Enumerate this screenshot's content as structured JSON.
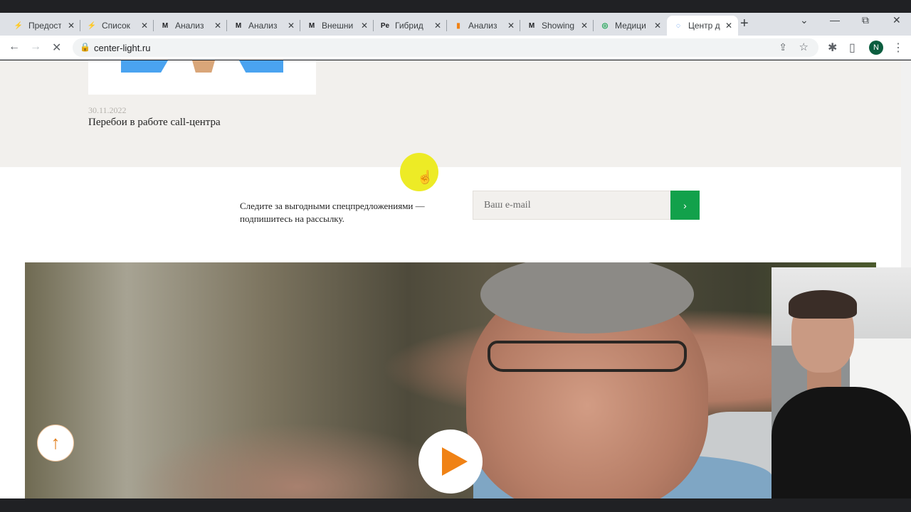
{
  "browser": {
    "tabs": [
      {
        "title": "Предост",
        "icon": "red-logo-icon",
        "color": "#d93025",
        "glyph": "⚡"
      },
      {
        "title": "Список",
        "icon": "red-logo-icon",
        "color": "#d93025",
        "glyph": "⚡"
      },
      {
        "title": "Анализ",
        "icon": "m-logo-icon",
        "color": "#202124",
        "glyph": "M"
      },
      {
        "title": "Анализ",
        "icon": "m-logo-icon",
        "color": "#202124",
        "glyph": "M"
      },
      {
        "title": "Внешни",
        "icon": "m-logo-icon",
        "color": "#202124",
        "glyph": "M"
      },
      {
        "title": "Гибрид",
        "icon": "pe-logo-icon",
        "color": "#202124",
        "glyph": "Pe"
      },
      {
        "title": "Анализ",
        "icon": "orange-logo-icon",
        "color": "#f08215",
        "glyph": "▮"
      },
      {
        "title": "Showing",
        "icon": "m-bird-logo-icon",
        "color": "#202124",
        "glyph": "M"
      },
      {
        "title": "Медици",
        "icon": "green-logo-icon",
        "color": "#12a14b",
        "glyph": "◎"
      },
      {
        "title": "Центр д",
        "icon": "loading-icon",
        "color": "#1a73e8",
        "glyph": "◌"
      }
    ],
    "active_tab_index": 9,
    "new_tab_symbol": "+",
    "url": "center-light.ru",
    "profile_initial": "N"
  },
  "page": {
    "news_date": "30.11.2022",
    "news_title": "Перебои в работе call-центра",
    "subscribe_text": "Следите за выгодными спецпредложениями — подпишитесь на рассылку.",
    "email_placeholder": "Ваш e-mail",
    "submit_symbol": "›",
    "scroll_up_symbol": "↑"
  },
  "colors": {
    "accent_green": "#12a14b",
    "play_orange": "#f08215",
    "news_bg": "#f2f0ed"
  }
}
